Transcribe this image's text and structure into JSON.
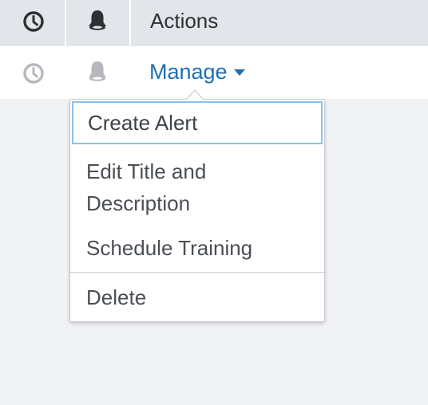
{
  "header": {
    "actions_label": "Actions",
    "history_icon": "clock-icon",
    "alerts_icon": "bell-icon"
  },
  "row": {
    "history_icon": "clock-icon",
    "alerts_icon": "bell-icon",
    "manage_label": "Manage"
  },
  "menu": {
    "items": [
      {
        "label": "Create Alert"
      },
      {
        "label": "Edit Title and Description"
      },
      {
        "label": "Schedule Training"
      },
      {
        "label": "Delete"
      }
    ]
  },
  "colors": {
    "accent": "#1f6fb2",
    "header_bg": "#e2e5e9",
    "page_bg": "#f1f2f4",
    "focus_ring": "#88c2ee"
  }
}
